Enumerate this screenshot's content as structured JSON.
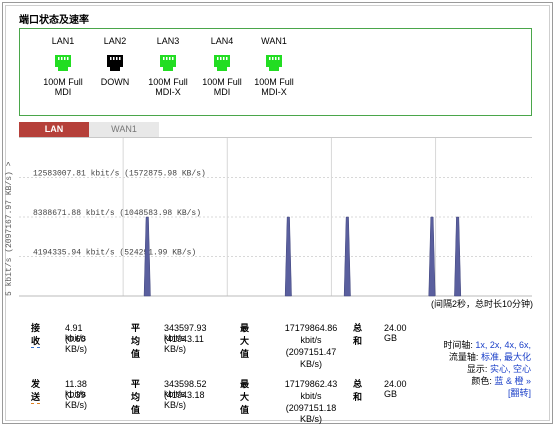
{
  "section": {
    "title": "端口状态及速率"
  },
  "ports": [
    {
      "name": "LAN1",
      "status": "green",
      "line1": "100M Full",
      "line2": "MDI"
    },
    {
      "name": "LAN2",
      "status": "black",
      "line1": "DOWN",
      "line2": ""
    },
    {
      "name": "LAN3",
      "status": "green",
      "line1": "100M Full",
      "line2": "MDI-X"
    },
    {
      "name": "LAN4",
      "status": "green",
      "line1": "100M Full",
      "line2": "MDI"
    },
    {
      "name": "WAN1",
      "status": "green",
      "line1": "100M Full",
      "line2": "MDI-X"
    }
  ],
  "colors": {
    "port_up": "#22dd22",
    "port_down": "#000000",
    "tab_active": "#b5403a",
    "spike": "#5a5f9e",
    "link": "#1a3fc8"
  },
  "tabs": {
    "lan": "LAN",
    "wan": "WAN1"
  },
  "chart_data": {
    "type": "area",
    "ylabel": "5 kbit/s (2097167.97 KB/s) >",
    "ylim": [
      0,
      16777343.6
    ],
    "gridlines": [
      {
        "value": 12583007.81,
        "label": "12583007.81 kbit/s (1572875.98 KB/s)"
      },
      {
        "value": 8388671.88,
        "label": "8388671.88 kbit/s (1048583.98 KB/s)"
      },
      {
        "value": 4194335.94,
        "label": "4194335.94 kbit/s (524291.99 KB/s)"
      }
    ],
    "spikes": [
      {
        "x": 0.25,
        "value": 8388671.88
      },
      {
        "x": 0.525,
        "value": 8388671.88
      },
      {
        "x": 0.64,
        "value": 8388671.88
      },
      {
        "x": 0.805,
        "value": 8388671.88
      },
      {
        "x": 0.855,
        "value": 8388671.88
      }
    ],
    "note": "(间隔2秒，总时长10分钟)"
  },
  "stats": {
    "recv": {
      "label": "接收",
      "current_kbit": "4.91 kbit/s",
      "current_kb": "(0.60 KB/s)",
      "avg_label": "平均值",
      "avg_kbit": "343597.93 kbit/s",
      "avg_kb": "(41943.11 KB/s)",
      "max_label": "最大值",
      "max_1": "17179864.86",
      "max_2": "kbit/s",
      "max_3": "(2097151.47",
      "max_4": "KB/s)",
      "total_label": "总和",
      "total": "24.00 GB"
    },
    "send": {
      "label": "发送",
      "current_kbit": "11.38 kbit/s",
      "current_kb": "(1.39 KB/s)",
      "avg_label": "平均值",
      "avg_kbit": "343598.52 kbit/s",
      "avg_kb": "(41943.18 KB/s)",
      "max_label": "最大值",
      "max_1": "17179862.43",
      "max_2": "kbit/s",
      "max_3": "(2097151.18",
      "max_4": "KB/s)",
      "total_label": "总和",
      "total": "24.00 GB"
    }
  },
  "options": {
    "time_label": "时间轴:",
    "time_values": [
      "1x,",
      "2x,",
      "4x,",
      "6x,"
    ],
    "flow_label": "流量轴:",
    "flow_values": [
      "标准,",
      "最大化"
    ],
    "display_label": "显示:",
    "display_values": [
      "实心,",
      "空心"
    ],
    "color_label": "颜色:",
    "color_values": [
      "蓝",
      "& 橙",
      "»"
    ],
    "flip": "[翻转]"
  }
}
